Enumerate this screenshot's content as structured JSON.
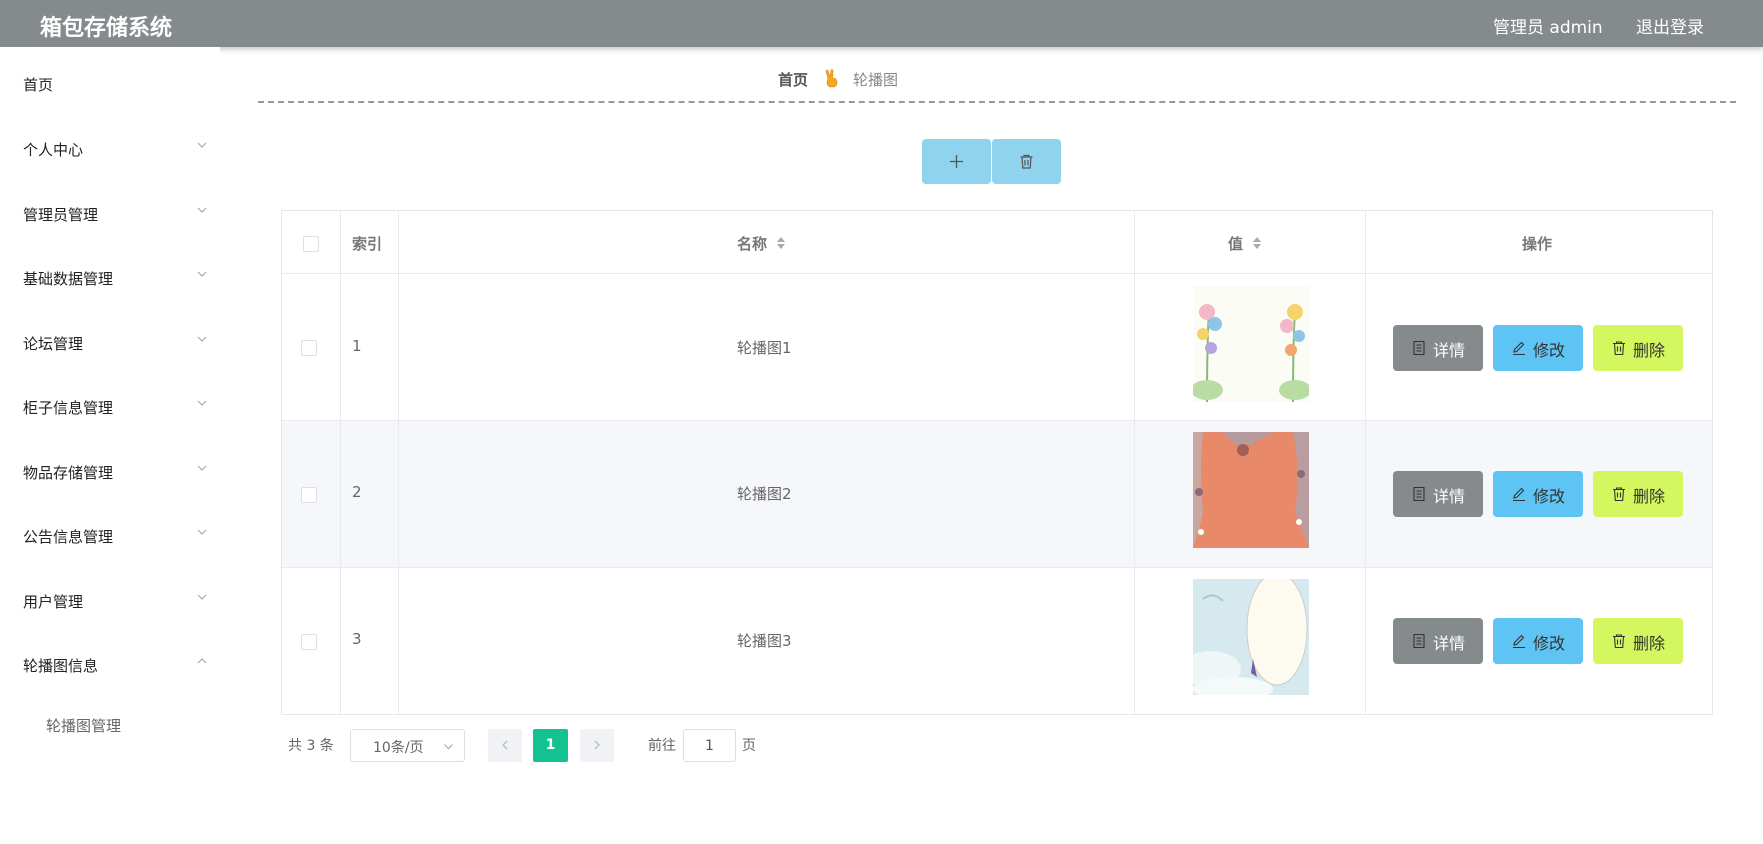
{
  "header": {
    "title": "箱包存储系统",
    "user": "管理员 admin",
    "logout": "退出登录"
  },
  "sidebar": {
    "items": [
      {
        "label": "首页",
        "has_arrow": false
      },
      {
        "label": "个人中心",
        "has_arrow": true,
        "expanded": false
      },
      {
        "label": "管理员管理",
        "has_arrow": true,
        "expanded": false
      },
      {
        "label": "基础数据管理",
        "has_arrow": true,
        "expanded": false
      },
      {
        "label": "论坛管理",
        "has_arrow": true,
        "expanded": false
      },
      {
        "label": "柜子信息管理",
        "has_arrow": true,
        "expanded": false
      },
      {
        "label": "物品存储管理",
        "has_arrow": true,
        "expanded": false
      },
      {
        "label": "公告信息管理",
        "has_arrow": true,
        "expanded": false
      },
      {
        "label": "用户管理",
        "has_arrow": true,
        "expanded": false
      },
      {
        "label": "轮播图信息",
        "has_arrow": true,
        "expanded": true
      }
    ],
    "submenu": [
      {
        "label": "轮播图管理"
      }
    ]
  },
  "breadcrumb": {
    "home": "首页",
    "current": "轮播图"
  },
  "toolbar": {
    "add_icon": "plus-icon",
    "delete_icon": "trash-icon"
  },
  "table": {
    "columns": [
      "索引",
      "名称",
      "值",
      "操作"
    ],
    "rows": [
      {
        "index": "1",
        "name": "轮播图1",
        "thumb": "flowers"
      },
      {
        "index": "2",
        "name": "轮播图2",
        "thumb": "orange-pattern"
      },
      {
        "index": "3",
        "name": "轮播图3",
        "thumb": "cloud-oval"
      }
    ],
    "actions": {
      "detail": "详情",
      "edit": "修改",
      "delete": "删除"
    }
  },
  "pagination": {
    "total": "共 3 条",
    "page_size": "10条/页",
    "current": "1",
    "goto_label": "前往",
    "goto_value": "1",
    "page_label": "页"
  },
  "colors": {
    "header_bg": "#858a8c",
    "tool_button": "#8fd3ee",
    "detail_button": "#858a8c",
    "edit_button": "#5ec4f4",
    "delete_button": "#d4f65e",
    "page_active": "#13c290"
  }
}
